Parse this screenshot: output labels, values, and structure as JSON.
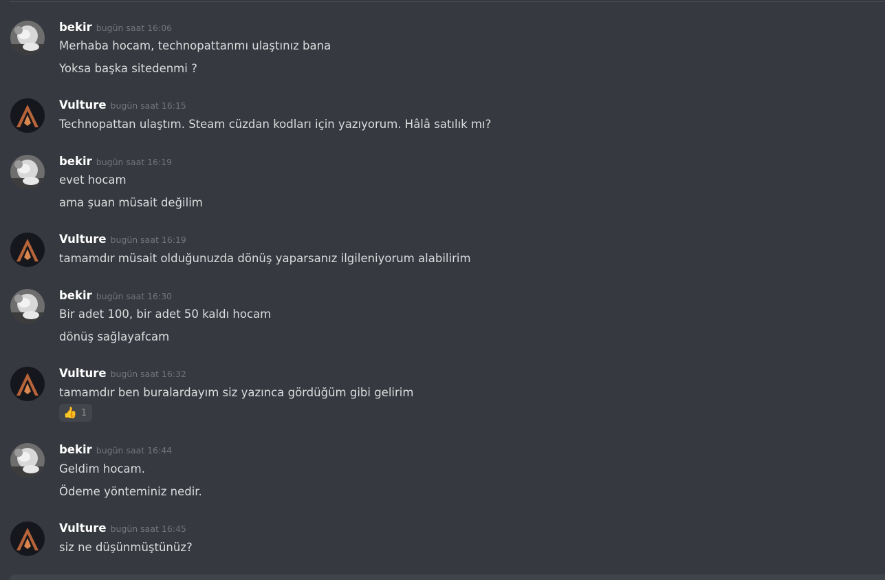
{
  "colors": {
    "background": "#36393f",
    "username": "#ffffff",
    "timestamp": "#72767d",
    "message_text": "#dcddde",
    "reaction_bg": "#42454a"
  },
  "messages": [
    {
      "author": "bekir",
      "avatar": "bekir-avatar",
      "timestamp": "bugün saat 16:06",
      "lines": [
        "Merhaba hocam, technopattanmı ulaştınız bana",
        "Yoksa başka sitedenmi ?"
      ]
    },
    {
      "author": "Vulture",
      "avatar": "vulture-avatar",
      "timestamp": "bugün saat 16:15",
      "lines": [
        "Technopattan ulaştım. Steam cüzdan kodları için yazıyorum. Hâlâ satılık mı?"
      ]
    },
    {
      "author": "bekir",
      "avatar": "bekir-avatar",
      "timestamp": "bugün saat 16:19",
      "lines": [
        "evet hocam",
        "ama şuan müsait değilim"
      ]
    },
    {
      "author": "Vulture",
      "avatar": "vulture-avatar",
      "timestamp": "bugün saat 16:19",
      "lines": [
        "tamamdır müsait olduğunuzda dönüş yaparsanız ilgileniyorum alabilirim"
      ]
    },
    {
      "author": "bekir",
      "avatar": "bekir-avatar",
      "timestamp": "bugün saat 16:30",
      "lines": [
        "Bir adet 100, bir adet 50 kaldı hocam",
        "dönüş sağlayafcam"
      ]
    },
    {
      "author": "Vulture",
      "avatar": "vulture-avatar",
      "timestamp": "bugün saat 16:32",
      "lines": [
        "tamamdır ben buralardayım siz yazınca gördüğüm gibi gelirim"
      ],
      "reaction": {
        "emoji": "👍",
        "icon": "thumbs-up-icon",
        "count": "1"
      }
    },
    {
      "author": "bekir",
      "avatar": "bekir-avatar",
      "timestamp": "bugün saat 16:44",
      "lines": [
        "Geldim hocam.",
        "Ödeme yönteminiz nedir."
      ]
    },
    {
      "author": "Vulture",
      "avatar": "vulture-avatar",
      "timestamp": "bugün saat 16:45",
      "lines": [
        "siz ne düşünmüştünüz?"
      ]
    }
  ]
}
